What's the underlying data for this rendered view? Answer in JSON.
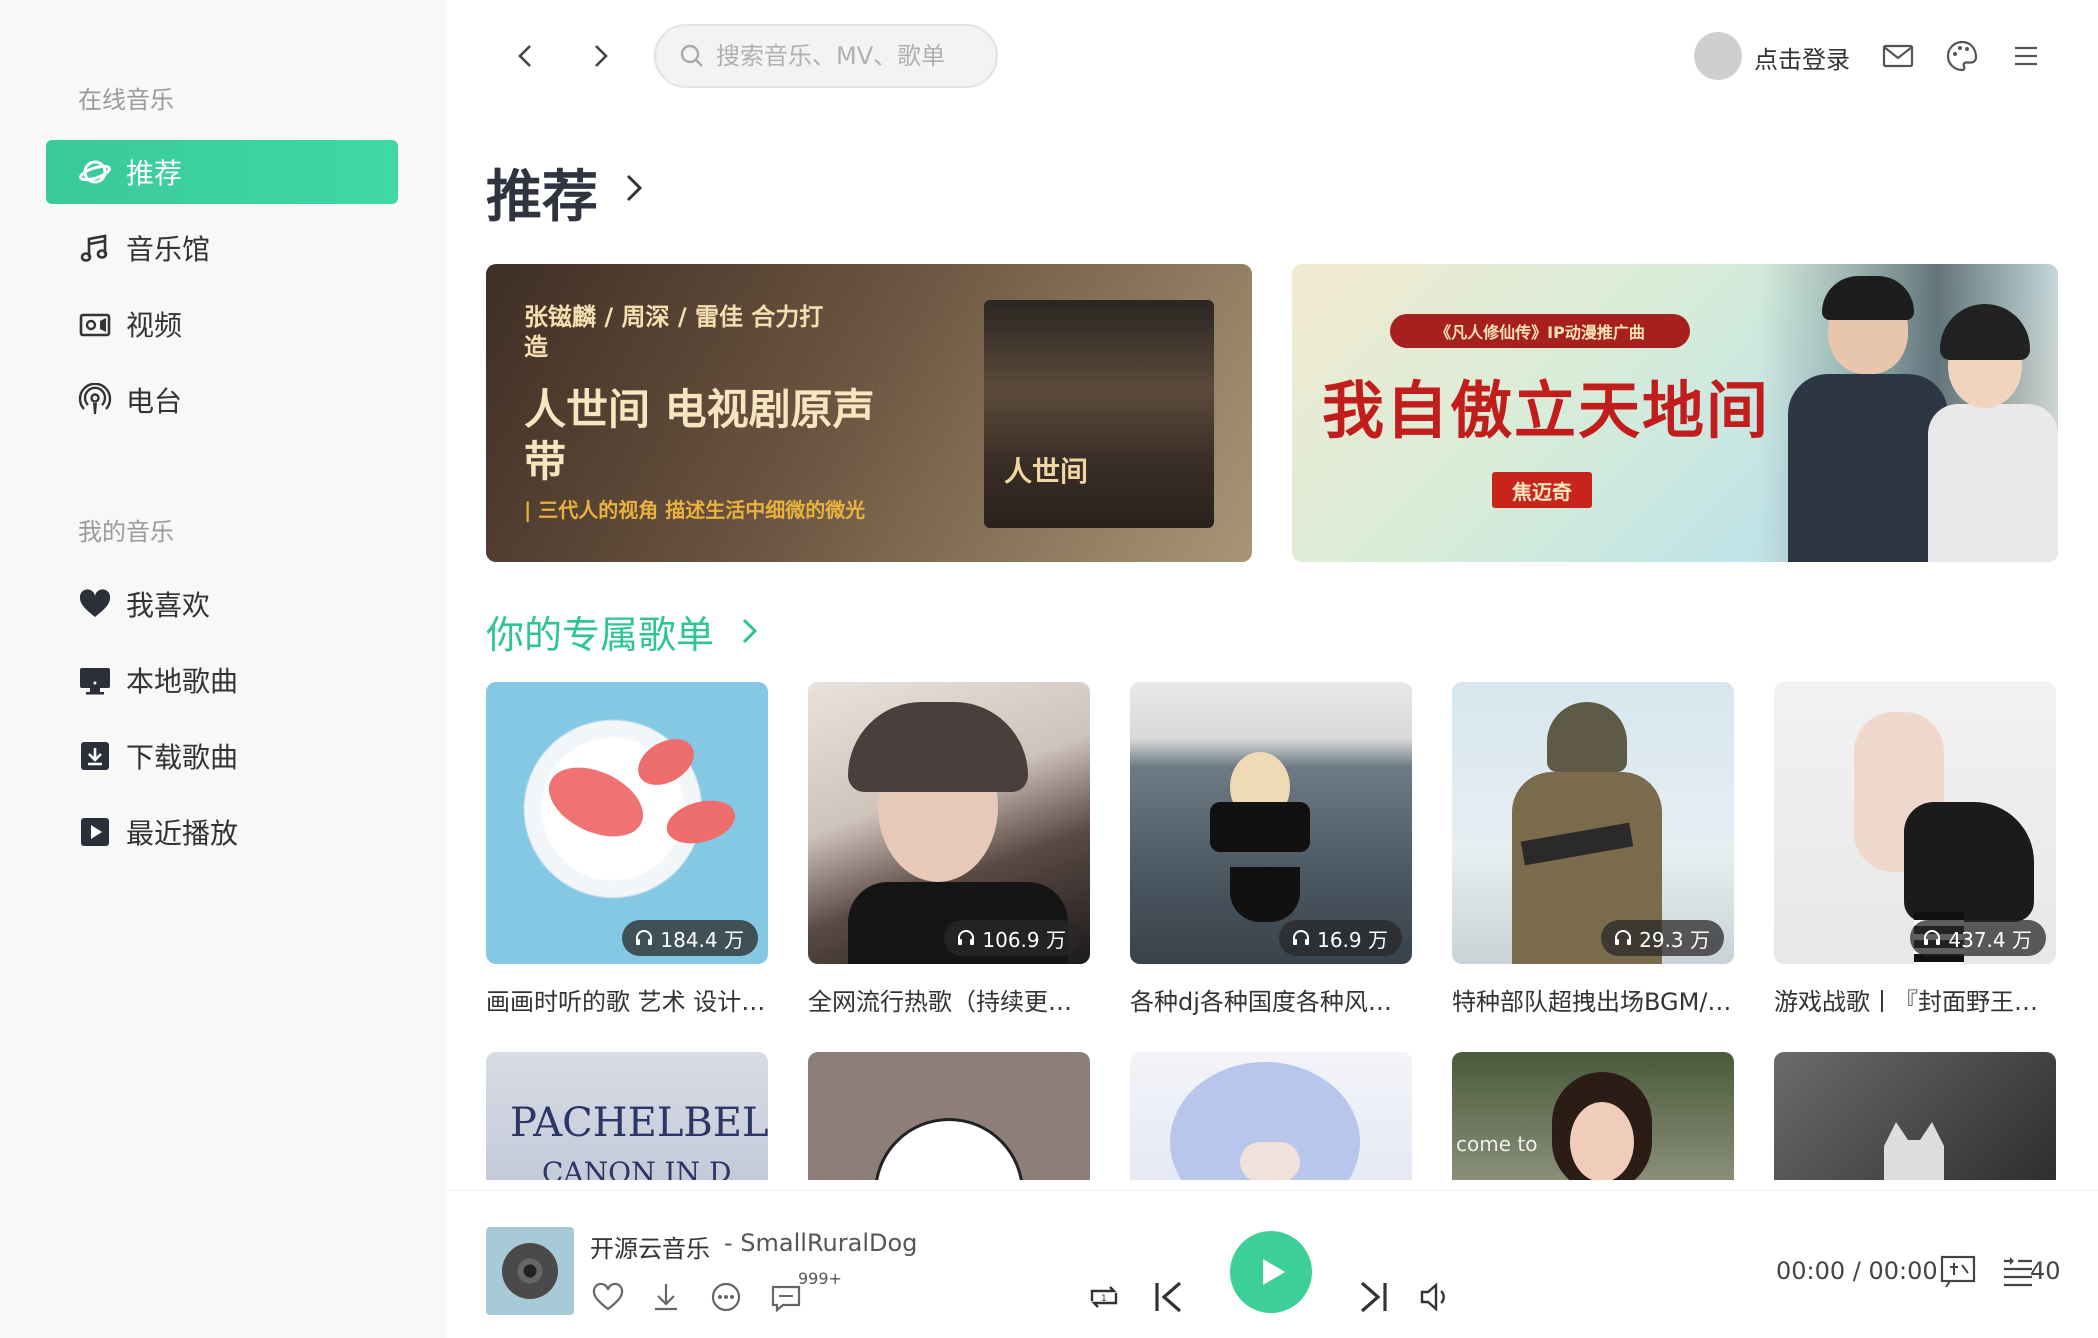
{
  "sidebar": {
    "section_online": "在线音乐",
    "online_items": [
      {
        "label": "推荐",
        "icon": "planet-icon",
        "active": true
      },
      {
        "label": "音乐馆",
        "icon": "music-note-icon"
      },
      {
        "label": "视频",
        "icon": "video-camera-icon"
      },
      {
        "label": "电台",
        "icon": "radio-podcast-icon"
      }
    ],
    "section_mine": "我的音乐",
    "mine_items": [
      {
        "label": "我喜欢",
        "icon": "heart-icon"
      },
      {
        "label": "本地歌曲",
        "icon": "computer-icon"
      },
      {
        "label": "下载歌曲",
        "icon": "download-box-icon"
      },
      {
        "label": "最近播放",
        "icon": "play-box-icon"
      }
    ]
  },
  "topbar": {
    "search_placeholder": "搜索音乐、MV、歌单",
    "login_label": "点击登录"
  },
  "main": {
    "title": "推荐",
    "banners": [
      {
        "subtitle": "张镃麟 / 周深 / 雷佳 合力打造",
        "title": "人世间 电视剧原声带",
        "tagline": "| 三代人的视角 描述生活中细微的微光",
        "photo_text": "人世间"
      },
      {
        "top_label": "《凡人修仙传》IP动漫推广曲",
        "main_text": "我自傲立天地间",
        "artist": "焦迈奇"
      }
    ],
    "section_title": "你的专属歌单",
    "playlists": [
      {
        "title": "画画时听的歌 艺术 设计…",
        "plays": "184.4 万"
      },
      {
        "title": "全网流行热歌（持续更…",
        "plays": "106.9 万"
      },
      {
        "title": "各种dj各种国度各种风…",
        "plays": "16.9 万"
      },
      {
        "title": "特种部队超拽出场BGM/…",
        "plays": "29.3 万"
      },
      {
        "title": "游戏战歌丨『封面野王…",
        "plays": "437.4 万"
      }
    ],
    "second_row_texts": [
      "PACHELBEL",
      "CANON IN D",
      "come to"
    ]
  },
  "player": {
    "title": "开源云音乐",
    "artist": "- SmallRuralDog",
    "comment_count": "999+",
    "time": "00:00 / 00:00",
    "playlist_count": "40"
  },
  "colors": {
    "accent": "#3ccf9a",
    "section_title": "#2fc592"
  }
}
